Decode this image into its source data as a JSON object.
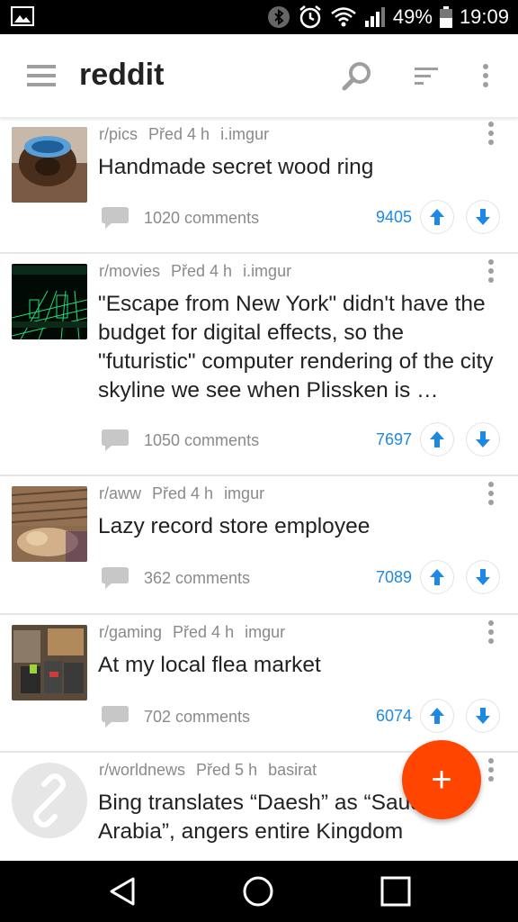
{
  "status": {
    "battery": "49%",
    "time": "19:09"
  },
  "app": {
    "title": "reddit"
  },
  "posts": [
    {
      "subreddit": "r/pics",
      "age": "Před 4 h",
      "domain": "i.imgur",
      "title": "Handmade secret wood ring",
      "comments": "1020 comments",
      "score": "9405"
    },
    {
      "subreddit": "r/movies",
      "age": "Před 4 h",
      "domain": "i.imgur",
      "title": "\"Escape from New York\" didn't have the budget for digital effects, so the \"futuristic\" computer rendering of the city skyline we see when Plissken is …",
      "comments": "1050 comments",
      "score": "7697"
    },
    {
      "subreddit": "r/aww",
      "age": "Před 4 h",
      "domain": "imgur",
      "title": "Lazy record store employee",
      "comments": "362 comments",
      "score": "7089"
    },
    {
      "subreddit": "r/gaming",
      "age": "Před 4 h",
      "domain": "imgur",
      "title": "At my local flea market",
      "comments": "702 comments",
      "score": "6074"
    },
    {
      "subreddit": "r/worldnews",
      "age": "Před 5 h",
      "domain": "basirat",
      "title": "Bing translates “Daesh” as “Saudi Arabia”, angers entire Kingdom"
    }
  ],
  "fab": {
    "label": "+"
  },
  "colors": {
    "accent": "#1e88e5",
    "fab": "#ff4500",
    "text": "#222222",
    "meta": "#8a8a8a"
  }
}
